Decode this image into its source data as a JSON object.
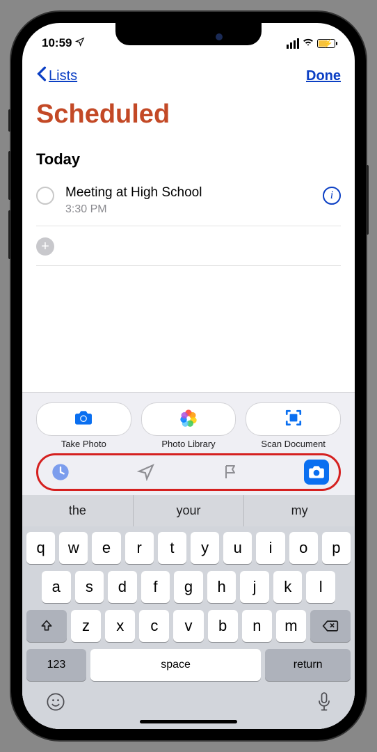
{
  "status": {
    "time": "10:59"
  },
  "nav": {
    "back": "Lists",
    "done": "Done"
  },
  "page": {
    "title": "Scheduled",
    "section": "Today"
  },
  "reminders": [
    {
      "title": "Meeting at High School",
      "time": "3:30 PM"
    }
  ],
  "cameraOptions": [
    {
      "label": "Take Photo"
    },
    {
      "label": "Photo Library"
    },
    {
      "label": "Scan Document"
    }
  ],
  "suggestions": [
    "the",
    "your",
    "my"
  ],
  "keyboard": {
    "row1": [
      "q",
      "w",
      "e",
      "r",
      "t",
      "y",
      "u",
      "i",
      "o",
      "p"
    ],
    "row2": [
      "a",
      "s",
      "d",
      "f",
      "g",
      "h",
      "j",
      "k",
      "l"
    ],
    "row3": [
      "z",
      "x",
      "c",
      "v",
      "b",
      "n",
      "m"
    ],
    "numKey": "123",
    "space": "space",
    "return": "return"
  }
}
